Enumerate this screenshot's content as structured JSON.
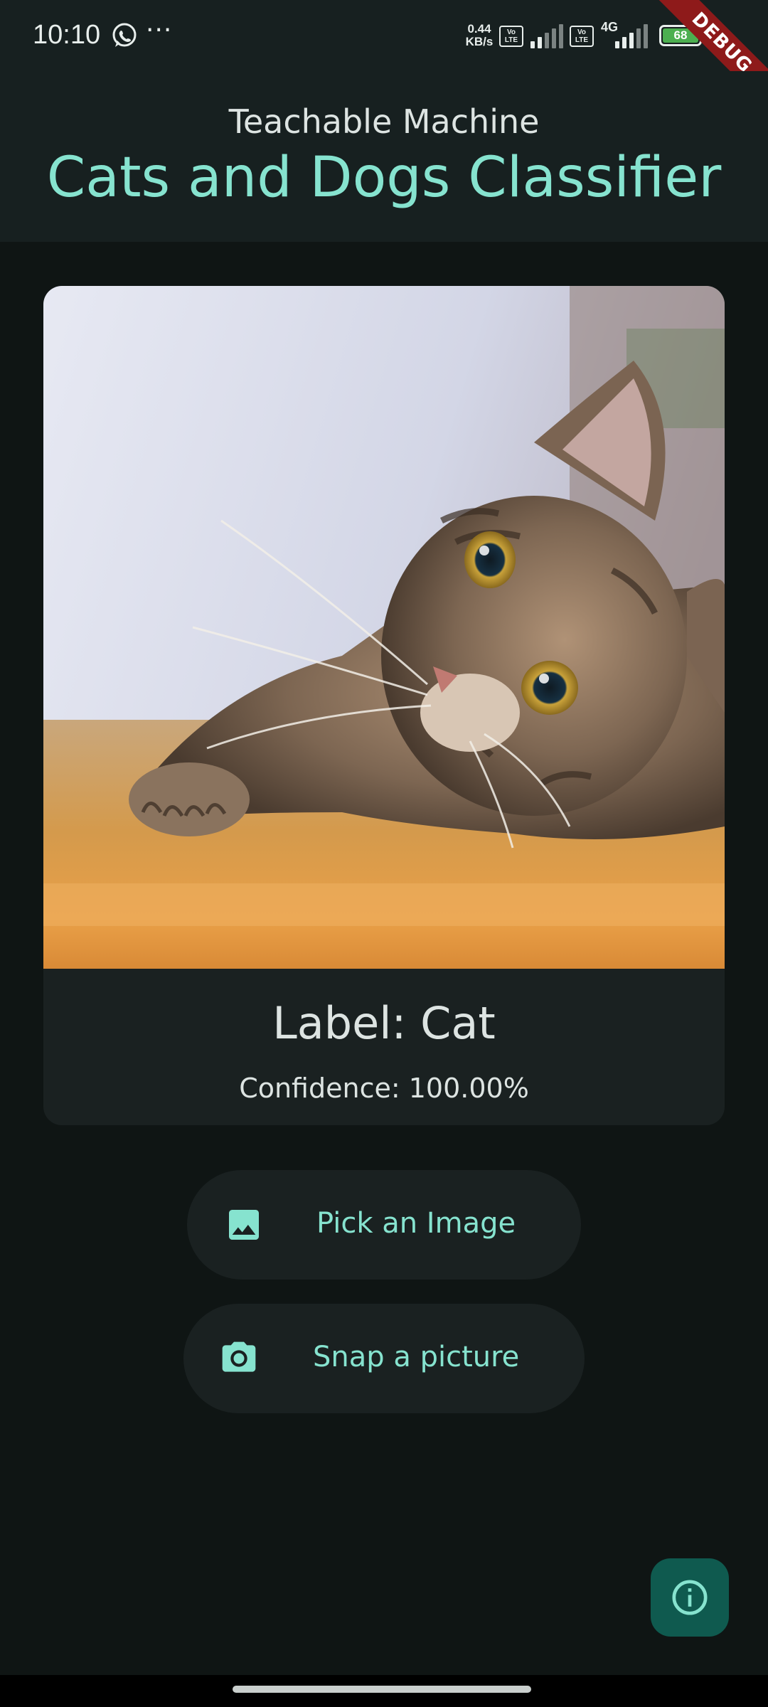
{
  "status_bar": {
    "time": "10:10",
    "more": "···",
    "net_speed_value": "0.44",
    "net_speed_unit": "KB/s",
    "volte_label": "Vo LTE",
    "network_type": "4G",
    "battery_level": "68",
    "debug_banner": "DEBUG",
    "icons": [
      "whatsapp-icon",
      "signal-icon",
      "battery-icon"
    ]
  },
  "app_bar": {
    "subtitle": "Teachable Machine",
    "title": "Cats and Dogs Classifier"
  },
  "result": {
    "label": "Label: Cat",
    "confidence": "Confidence: 100.00%"
  },
  "actions": {
    "pick_image_label": "Pick an Image",
    "snap_picture_label": "Snap a picture"
  },
  "fab": {
    "icon": "info-icon"
  },
  "colors": {
    "accent": "#86e3cf",
    "background": "#0f1514",
    "surface": "#1a2121",
    "fab": "#0f5a4f",
    "debug": "#8e1a1a"
  }
}
